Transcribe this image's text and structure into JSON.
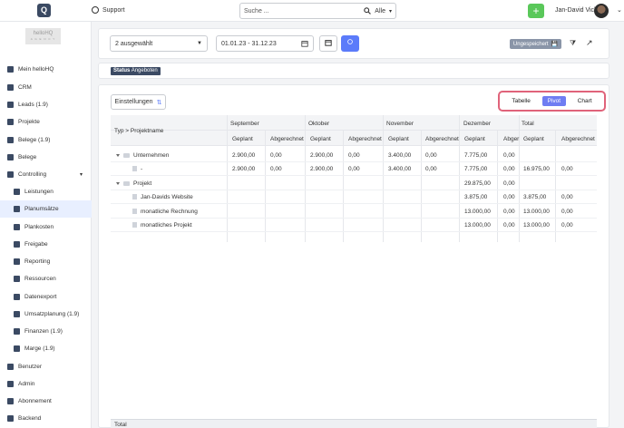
{
  "topbar": {
    "logo": "Q",
    "support_label": "Support",
    "search_placeholder": "Suche ...",
    "search_scope": "Alle",
    "add_label": "+",
    "user_name": "Jan-David Vick"
  },
  "sidebar": {
    "brand_line1": "helloHQ",
    "brand_line2": "A G E N C Y",
    "items": [
      {
        "label": "Mein helloHQ"
      },
      {
        "label": "CRM"
      },
      {
        "label": "Leads (1.9)"
      },
      {
        "label": "Projekte"
      },
      {
        "label": "Belege (1.9)"
      },
      {
        "label": "Belege"
      },
      {
        "label": "Controlling"
      },
      {
        "label": "Leistungen"
      },
      {
        "label": "Planumsätze"
      },
      {
        "label": "Plankosten"
      },
      {
        "label": "Freigabe"
      },
      {
        "label": "Reporting"
      },
      {
        "label": "Ressourcen"
      },
      {
        "label": "Datenexport"
      },
      {
        "label": "Umsatzplanung (1.9)"
      },
      {
        "label": "Finanzen (1.9)"
      },
      {
        "label": "Marge (1.9)"
      },
      {
        "label": "Benutzer"
      },
      {
        "label": "Admin"
      },
      {
        "label": "Abonnement"
      },
      {
        "label": "Backend"
      }
    ]
  },
  "filters": {
    "selection": "2 ausgewählt",
    "date_range": "01.01.23 - 31.12.23",
    "unsaved_label": "Ungespeichert",
    "status_key": "Status",
    "status_value": "Angeboten"
  },
  "pivot": {
    "settings_label": "Einstellungen",
    "views": [
      "Tabelle",
      "Pivot",
      "Chart"
    ],
    "active_view": "Pivot",
    "row_header_typ": "Typ",
    "row_header_name": "Projektname",
    "months": [
      "September",
      "Oktober",
      "November",
      "Dezember",
      "Total"
    ],
    "subheaders": [
      "Geplant",
      "Abgerechnet",
      "Geplant",
      "Abgerechnet",
      "Geplant",
      "Abgerechnet",
      "Geplant",
      "Abger",
      "Geplant",
      "Abgerechnet"
    ],
    "rows": [
      {
        "label": "Unternehmen",
        "kind": "group",
        "cells": [
          "2.900,00",
          "0,00",
          "2.900,00",
          "0,00",
          "3.400,00",
          "0,00",
          "7.775,00",
          "0,00",
          "",
          ""
        ]
      },
      {
        "label": "-",
        "kind": "item",
        "cells": [
          "2.900,00",
          "0,00",
          "2.900,00",
          "0,00",
          "3.400,00",
          "0,00",
          "7.775,00",
          "0,00",
          "16.975,00",
          "0,00"
        ]
      },
      {
        "label": "Projekt",
        "kind": "group",
        "cells": [
          "",
          "",
          "",
          "",
          "",
          "",
          "29.875,00",
          "0,00",
          "",
          ""
        ]
      },
      {
        "label": "Jan-Davids Website",
        "kind": "item",
        "cells": [
          "",
          "",
          "",
          "",
          "",
          "",
          "3.875,00",
          "0,00",
          "3.875,00",
          "0,00"
        ]
      },
      {
        "label": "monatliche Rechnung",
        "kind": "item",
        "cells": [
          "",
          "",
          "",
          "",
          "",
          "",
          "13.000,00",
          "0,00",
          "13.000,00",
          "0,00"
        ]
      },
      {
        "label": "monatliches Projekt",
        "kind": "item",
        "cells": [
          "",
          "",
          "",
          "",
          "",
          "",
          "13.000,00",
          "0,00",
          "13.000,00",
          "0,00"
        ]
      }
    ],
    "total_label": "Total"
  }
}
